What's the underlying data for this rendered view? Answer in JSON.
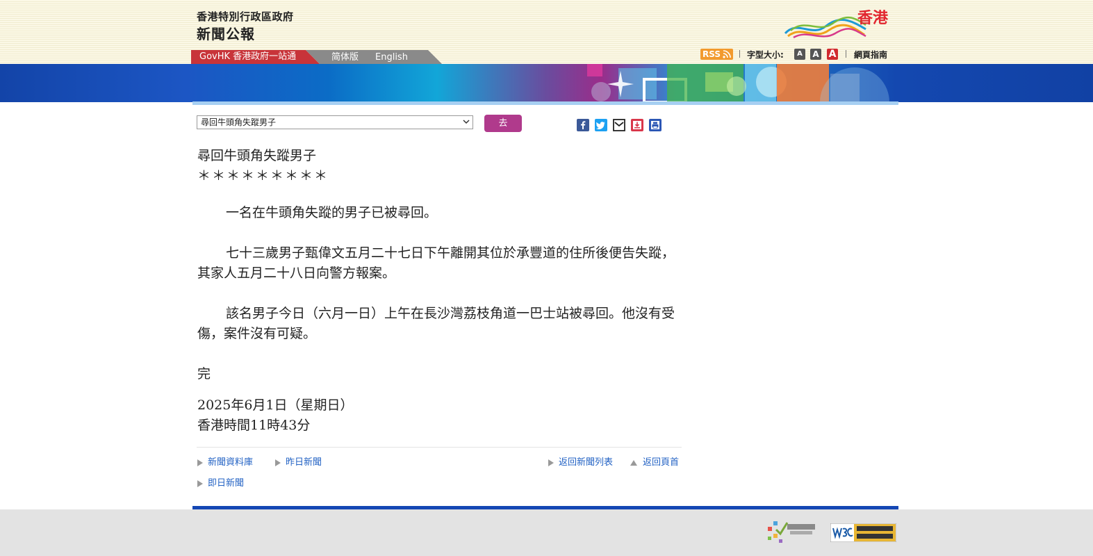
{
  "header": {
    "org_name": "香港特別行政區政府",
    "site_name": "新聞公報",
    "logo_text": "香港"
  },
  "nav": {
    "govhk": "GovHK 香港政府一站通",
    "simplified": "简体版",
    "english": "English"
  },
  "tools": {
    "rss": "RSS",
    "font_size_label": "字型大小:",
    "font_small": "A",
    "font_medium": "A",
    "font_large": "A",
    "web_guide": "網頁指南"
  },
  "selector": {
    "selected": "尋回牛頭角失蹤男子",
    "go_label": "去"
  },
  "article": {
    "title": "尋回牛頭角失蹤男子",
    "stars": "＊＊＊＊＊＊＊＊＊",
    "para1": "一名在牛頭角失蹤的男子已被尋回。",
    "para2": "七十三歲男子甄偉文五月二十七日下午離開其位於承豐道的住所後便告失蹤，其家人五月二十八日向警方報案。",
    "para3": "該名男子今日（六月一日）上午在長沙灣荔枝角道一巴士站被尋回。他沒有受傷，案件沒有可疑。",
    "end": "完",
    "date": "2025年6月1日（星期日）",
    "time": "香港時間11時43分"
  },
  "footer_links": {
    "archive": "新聞資料庫",
    "yesterday": "昨日新聞",
    "back_list": "返回新聞列表",
    "back_top": "返回頁首",
    "today": "即日新聞"
  },
  "colors": {
    "govhk_red": "#c8343a",
    "link_blue": "#2463c4",
    "go_button": "#b03a8c",
    "rss_orange": "#f29a2e"
  }
}
